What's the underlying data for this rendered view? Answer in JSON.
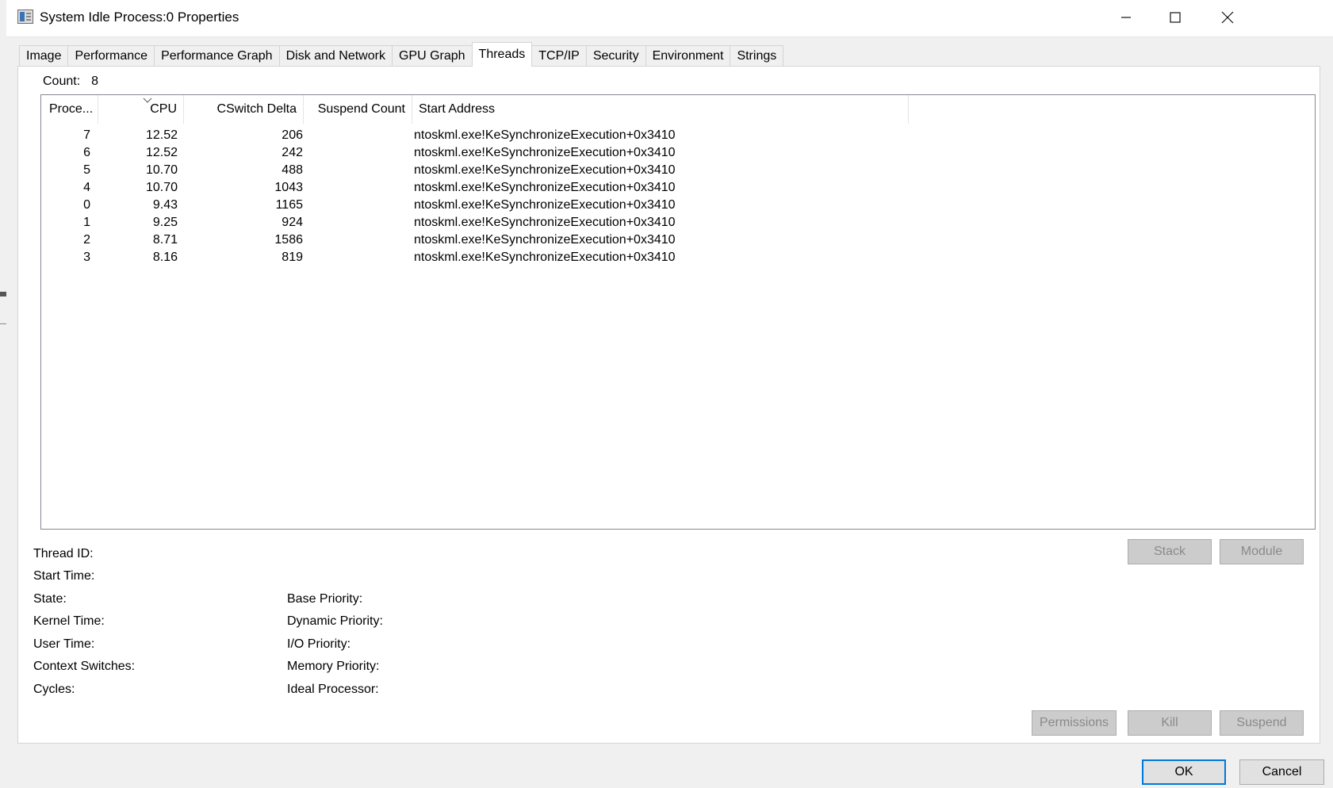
{
  "window": {
    "title": "System Idle Process:0 Properties",
    "minimize": "—",
    "maximize": "☐",
    "close": "✕"
  },
  "tabs": [
    {
      "label": "Image"
    },
    {
      "label": "Performance"
    },
    {
      "label": "Performance Graph"
    },
    {
      "label": "Disk and Network"
    },
    {
      "label": "GPU Graph"
    },
    {
      "label": "Threads",
      "active": true
    },
    {
      "label": "TCP/IP"
    },
    {
      "label": "Security"
    },
    {
      "label": "Environment"
    },
    {
      "label": "Strings"
    }
  ],
  "count": {
    "label": "Count:",
    "value": "8"
  },
  "threads": {
    "columns": [
      "Proce...",
      "CPU",
      "CSwitch Delta",
      "Suspend Count",
      "Start Address"
    ],
    "sort_icon": "chevron-down-icon",
    "rows": [
      {
        "proc": "7",
        "cpu": "12.52",
        "cswitch": "206",
        "suspend": "",
        "start": "ntoskml.exe!KeSynchronizeExecution+0x3410"
      },
      {
        "proc": "6",
        "cpu": "12.52",
        "cswitch": "242",
        "suspend": "",
        "start": "ntoskml.exe!KeSynchronizeExecution+0x3410"
      },
      {
        "proc": "5",
        "cpu": "10.70",
        "cswitch": "488",
        "suspend": "",
        "start": "ntoskml.exe!KeSynchronizeExecution+0x3410"
      },
      {
        "proc": "4",
        "cpu": "10.70",
        "cswitch": "1043",
        "suspend": "",
        "start": "ntoskml.exe!KeSynchronizeExecution+0x3410"
      },
      {
        "proc": "0",
        "cpu": "9.43",
        "cswitch": "1165",
        "suspend": "",
        "start": "ntoskml.exe!KeSynchronizeExecution+0x3410"
      },
      {
        "proc": "1",
        "cpu": "9.25",
        "cswitch": "924",
        "suspend": "",
        "start": "ntoskml.exe!KeSynchronizeExecution+0x3410"
      },
      {
        "proc": "2",
        "cpu": "8.71",
        "cswitch": "1586",
        "suspend": "",
        "start": "ntoskml.exe!KeSynchronizeExecution+0x3410"
      },
      {
        "proc": "3",
        "cpu": "8.16",
        "cswitch": "819",
        "suspend": "",
        "start": "ntoskml.exe!KeSynchronizeExecution+0x3410"
      }
    ]
  },
  "details": {
    "left": [
      "Thread ID:",
      "Start Time:",
      "State:",
      "Kernel Time:",
      "User Time:",
      "Context Switches:",
      "Cycles:"
    ],
    "right": [
      "Base Priority:",
      "Dynamic Priority:",
      "I/O Priority:",
      "Memory Priority:",
      "Ideal Processor:"
    ]
  },
  "buttons": {
    "stack": "Stack",
    "module": "Module",
    "permissions": "Permissions",
    "kill": "Kill",
    "suspend": "Suspend",
    "ok": "OK",
    "cancel": "Cancel"
  },
  "colors": {
    "default_button_border": "#0078d7",
    "disabled_text": "#8a8a8a"
  }
}
